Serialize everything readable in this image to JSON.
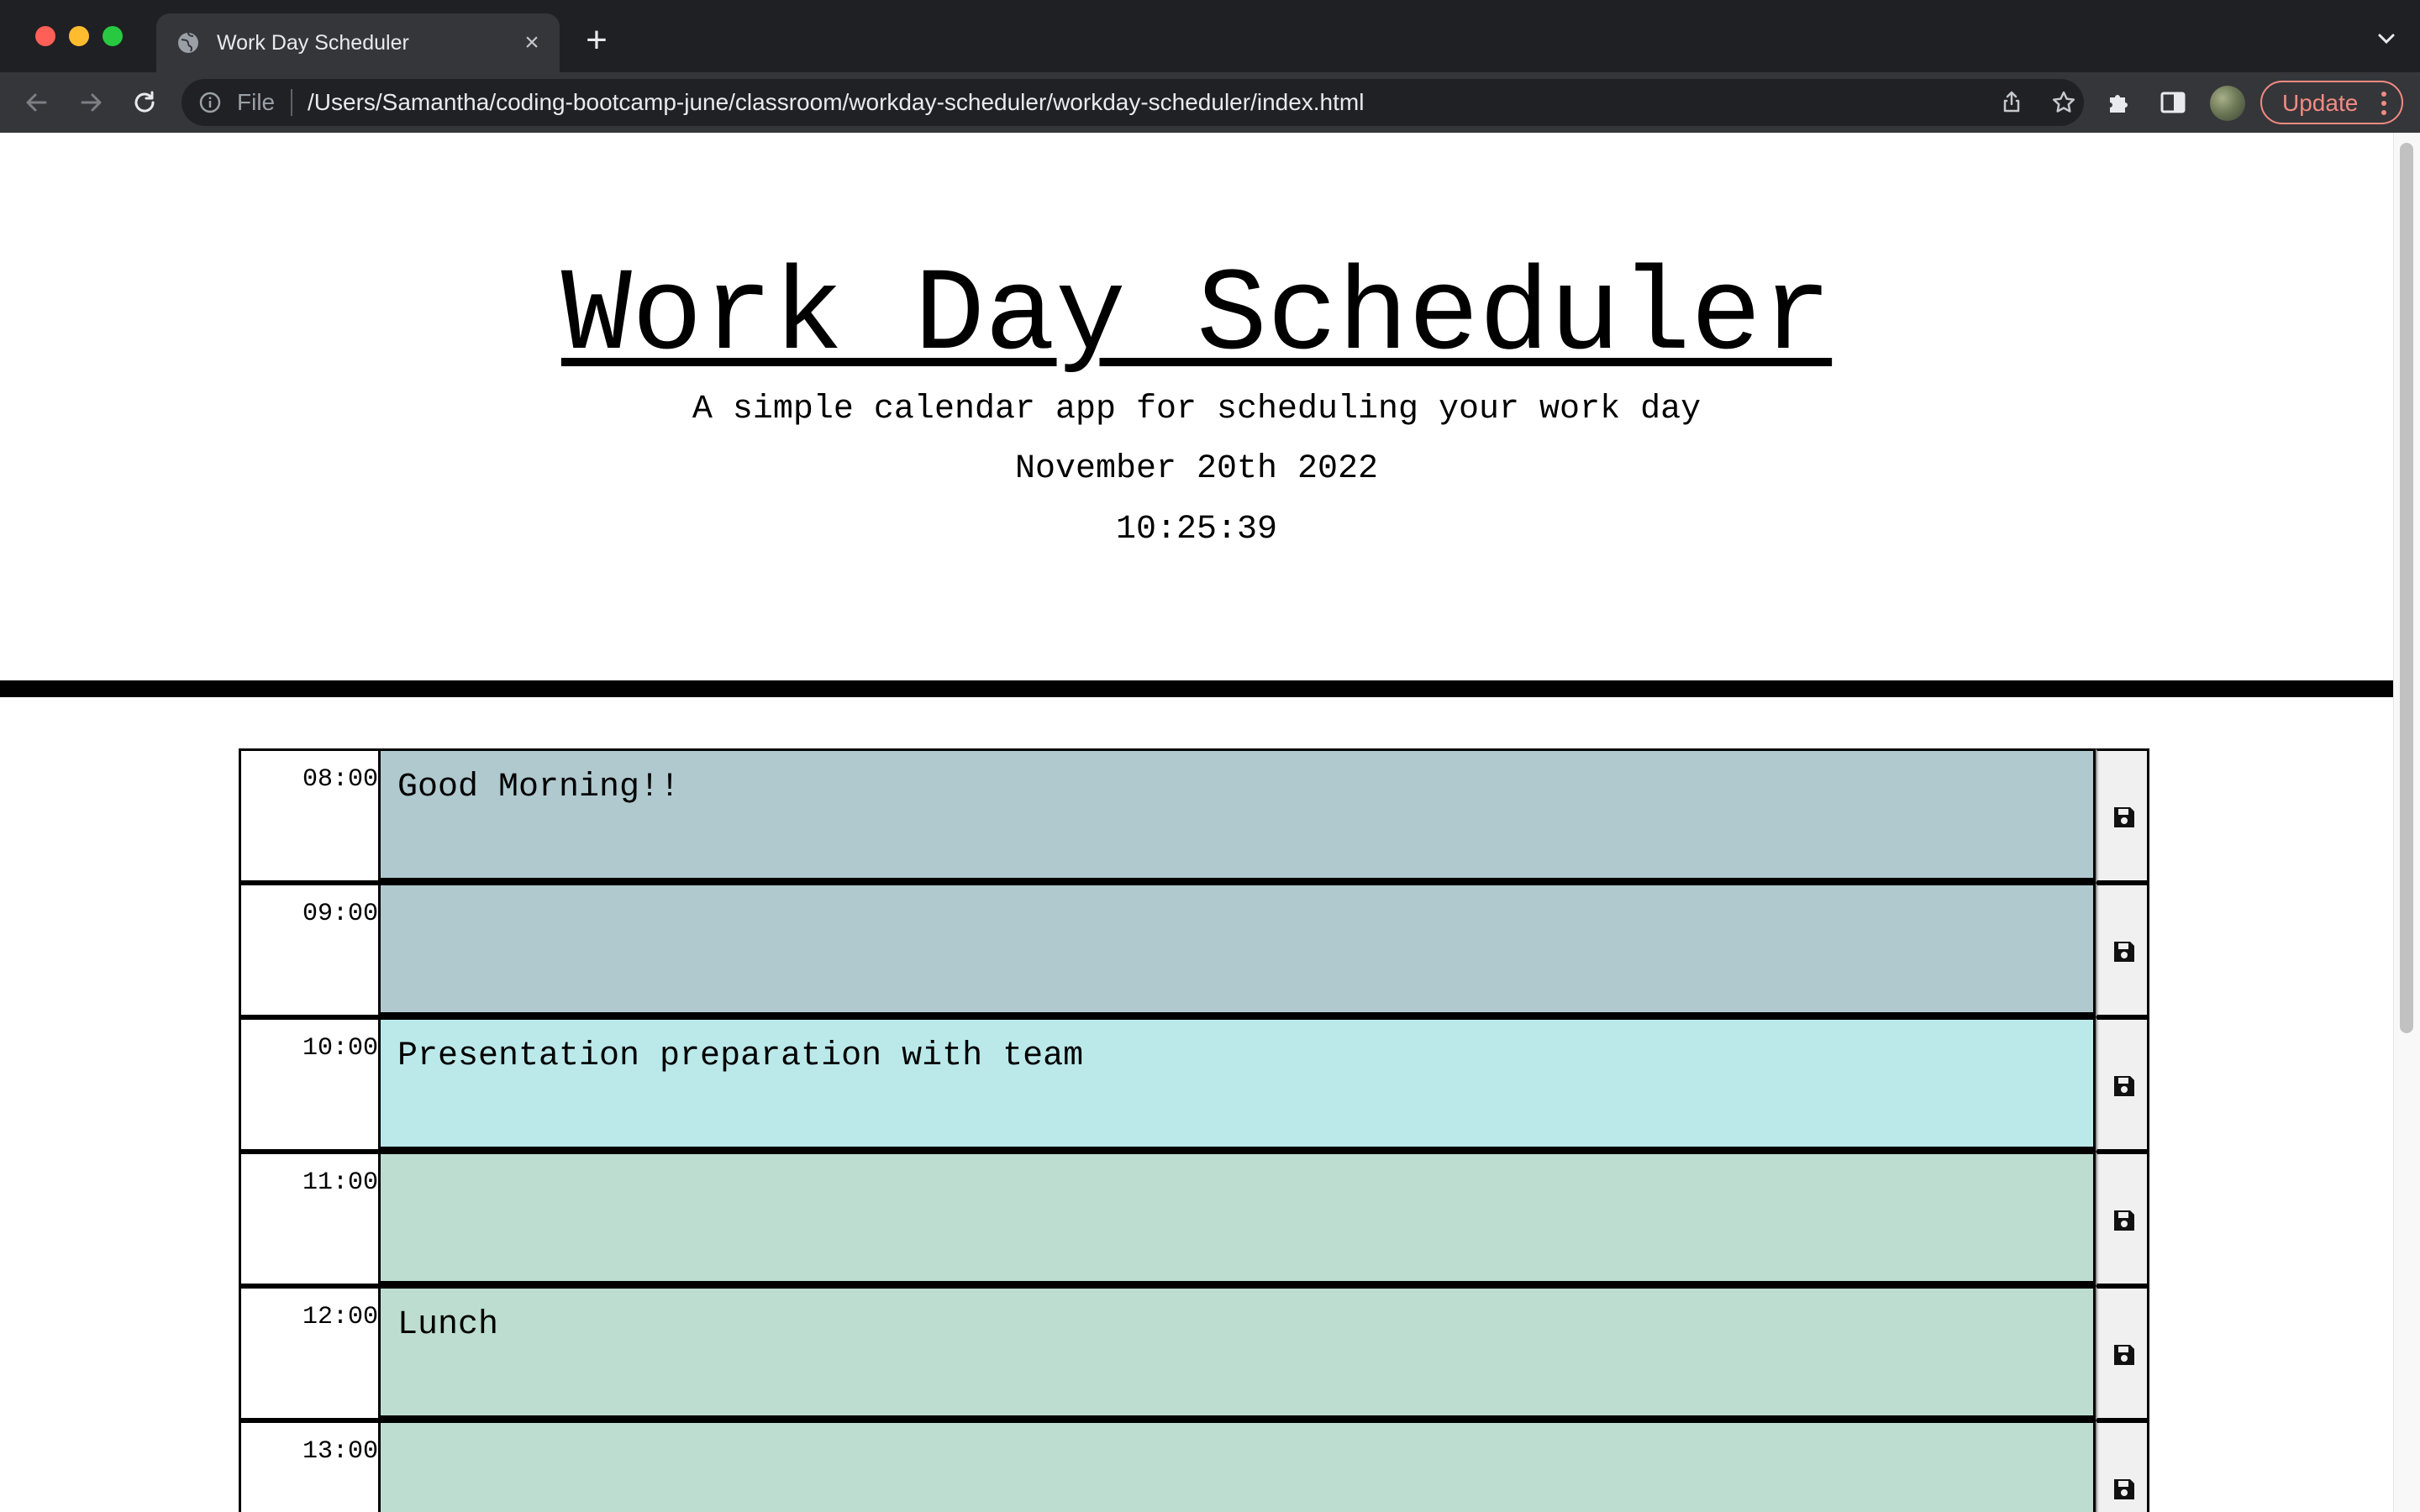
{
  "browser": {
    "tab_title": "Work Day Scheduler",
    "url_scheme": "File",
    "url": "/Users/Samantha/coding-bootcamp-june/classroom/workday-scheduler/workday-scheduler/index.html",
    "update_label": "Update"
  },
  "header": {
    "title": "Work Day Scheduler",
    "lead": "A simple calendar app for scheduling your work day",
    "date": "November 20th 2022",
    "time": "10:25:39"
  },
  "schedule": {
    "rows": [
      {
        "hour": "08:00",
        "text": "Good Morning!!",
        "state": "past"
      },
      {
        "hour": "09:00",
        "text": "",
        "state": "past"
      },
      {
        "hour": "10:00",
        "text": "Presentation preparation with team",
        "state": "present"
      },
      {
        "hour": "11:00",
        "text": "",
        "state": "future"
      },
      {
        "hour": "12:00",
        "text": "Lunch",
        "state": "future"
      },
      {
        "hour": "13:00",
        "text": "",
        "state": "future"
      }
    ]
  },
  "colors": {
    "past": "#b0c9cf",
    "present": "#bbe9ea",
    "future": "#bcddd0",
    "divider": "#000000"
  },
  "icons": {
    "save": "floppy-disk-icon"
  }
}
